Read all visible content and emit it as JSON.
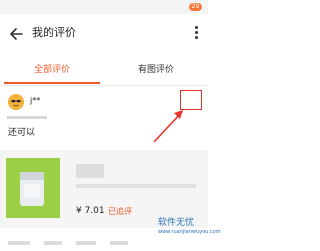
{
  "status_bar": {
    "badge": "29"
  },
  "nav": {
    "title": "我的评价"
  },
  "tabs": [
    {
      "label": "全部评价",
      "active": true
    },
    {
      "label": "有图评价",
      "active": false
    }
  ],
  "review": {
    "username": "j**",
    "text": "还可以",
    "product": {
      "price": "¥ 7.01",
      "status": "已追评"
    }
  },
  "annotation": {
    "color": "#e8352b"
  },
  "accent_color": "#f05a28",
  "watermark": {
    "cn": "软件无忧",
    "en": "www.ruanjianwuyou.com"
  },
  "icons": [
    "back-arrow-icon",
    "more-dots-icon",
    "avatar-emoji-icon"
  ]
}
